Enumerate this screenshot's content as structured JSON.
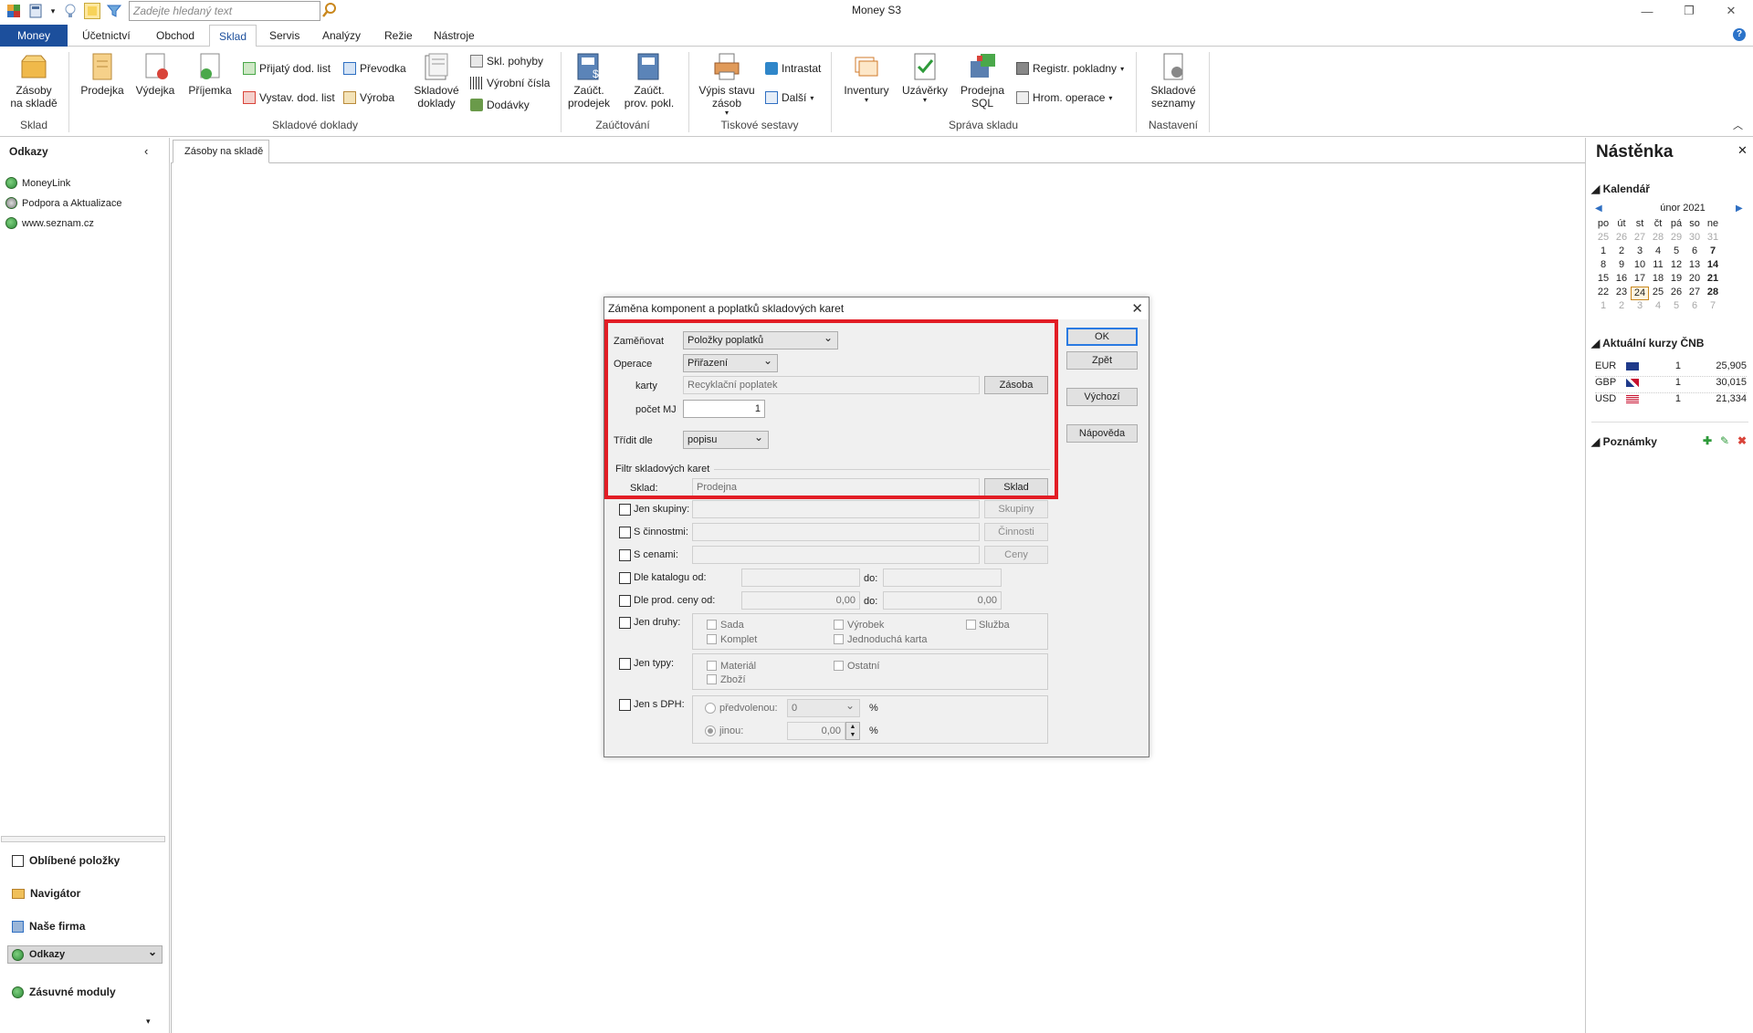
{
  "window": {
    "title": "Money S3",
    "search_placeholder": "Zadejte hledaný text"
  },
  "menu_tabs": [
    "Money",
    "Účetnictví",
    "Obchod",
    "Sklad",
    "Servis",
    "Analýzy",
    "Režie",
    "Nástroje"
  ],
  "active_tab": "Sklad",
  "ribbon": {
    "sklad": {
      "btn": "Zásoby\nna skladě",
      "group": "Sklad"
    },
    "skladove_doklady": {
      "prodejka": "Prodejka",
      "vydejka": "Výdejka",
      "prijemka": "Příjemka",
      "prijaty": "Přijatý dod. list",
      "vystav": "Vystav. dod. list",
      "prevodka": "Převodka",
      "vyroba": "Výroba",
      "doklady": "Skladové\ndoklady",
      "pohyby": "Skl. pohyby",
      "cisla": "Výrobní čísla",
      "dodavky": "Dodávky",
      "group": "Skladové doklady"
    },
    "zauctovani": {
      "prodejek": "Zaúčt.\nprodejek",
      "prov": "Zaúčt.\nprov. pokl.",
      "group": "Zaúčtování"
    },
    "tiskove": {
      "vypis": "Výpis stavu\nzásob",
      "intrastat": "Intrastat",
      "dalsi": "Další",
      "group": "Tiskové sestavy"
    },
    "sprava": {
      "inventury": "Inventury",
      "uzaverky": "Uzávěrky",
      "sql": "Prodejna\nSQL",
      "registr": "Registr. pokladny",
      "hrom": "Hrom. operace",
      "group": "Správa skladu"
    },
    "nastaveni": {
      "seznamy": "Skladové\nseznamy",
      "group": "Nastavení"
    }
  },
  "left_panel": {
    "title": "Odkazy",
    "links": [
      "MoneyLink",
      "Podpora a Aktualizace",
      "www.seznam.cz"
    ],
    "nav": [
      "Oblíbené položky",
      "Navigátor",
      "Naše firma",
      "Odkazy",
      "Zásuvné moduly"
    ]
  },
  "doc_tab": "Zásoby na skladě",
  "right_panel": {
    "title": "Nástěnka",
    "calendar_title": "Kalendář",
    "month": "únor 2021",
    "weekdays": [
      "po",
      "út",
      "st",
      "čt",
      "pá",
      "so",
      "ne"
    ],
    "weeks": [
      [
        "25",
        "26",
        "27",
        "28",
        "29",
        "30",
        "31"
      ],
      [
        "1",
        "2",
        "3",
        "4",
        "5",
        "6",
        "7"
      ],
      [
        "8",
        "9",
        "10",
        "11",
        "12",
        "13",
        "14"
      ],
      [
        "15",
        "16",
        "17",
        "18",
        "19",
        "20",
        "21"
      ],
      [
        "22",
        "23",
        "24",
        "25",
        "26",
        "27",
        "28"
      ],
      [
        "1",
        "2",
        "3",
        "4",
        "5",
        "6",
        "7"
      ]
    ],
    "rates_title": "Aktuální kurzy ČNB",
    "rates": [
      {
        "cur": "EUR",
        "amt": "1",
        "rate": "25,905"
      },
      {
        "cur": "GBP",
        "amt": "1",
        "rate": "30,015"
      },
      {
        "cur": "USD",
        "amt": "1",
        "rate": "21,334"
      }
    ],
    "notes_title": "Poznámky"
  },
  "dialog": {
    "title": "Záměna komponent a poplatků skladových karet",
    "zamenovat_label": "Zaměňovat",
    "zamenovat_value": "Položky poplatků",
    "operace_label": "Operace",
    "operace_value": "Přiřazení",
    "karty_label": "karty",
    "karty_value": "Recyklační poplatek",
    "zasoba_btn": "Zásoba",
    "pocet_label": "počet MJ",
    "pocet_value": "1",
    "tridit_label": "Třídit dle",
    "tridit_value": "popisu",
    "filtr_label": "Filtr skladových  karet",
    "sklad_label": "Sklad:",
    "sklad_value": "Prodejna",
    "sklad_btn": "Sklad",
    "jen_skupiny": "Jen skupiny:",
    "skupiny_btn": "Skupiny",
    "s_cinnostmi": "S činnostmi:",
    "cinnosti_btn": "Činnosti",
    "s_cenami": "S cenami:",
    "ceny_btn": "Ceny",
    "dle_katalogu": "Dle katalogu od:",
    "do1": "do:",
    "dle_ceny": "Dle prod. ceny od:",
    "do2": "do:",
    "cena_od": "0,00",
    "cena_do": "0,00",
    "jen_druhy": "Jen druhy:",
    "druhy": [
      "Sada",
      "Výrobek",
      "Služba",
      "Komplet",
      "Jednoduchá karta"
    ],
    "jen_typy": "Jen typy:",
    "typy": [
      "Materiál",
      "Ostatní",
      "Zboží"
    ],
    "jen_dph": "Jen s DPH:",
    "predvolenou": "předvolenou:",
    "pred_value": "0",
    "pct": "%",
    "jinou": "jinou:",
    "jinou_value": "0,00",
    "ok": "OK",
    "zpet": "Zpět",
    "vychozi": "Výchozí",
    "napoveda": "Nápověda"
  }
}
